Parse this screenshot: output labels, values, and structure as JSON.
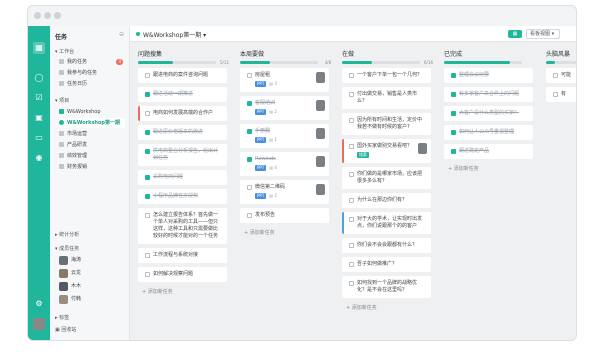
{
  "app": {
    "sidebar_title": "任务",
    "project_title": "W&Workshop第一期",
    "view_label": "看板视图"
  },
  "sidebar": {
    "workspace_label": "工作台",
    "items": [
      {
        "label": "我的任务",
        "badge": "4"
      },
      {
        "label": "我参与的任务"
      },
      {
        "label": "任务日历"
      }
    ],
    "project_label": "项目",
    "projects": [
      {
        "label": "W&Workshop"
      },
      {
        "label": "W&Workshop第一期"
      },
      {
        "label": "市场运营"
      },
      {
        "label": "产品研发"
      },
      {
        "label": "绩效管理"
      },
      {
        "label": "财务报销"
      }
    ],
    "stats_label": "统计分析",
    "members_label": "成员任务",
    "members": [
      {
        "name": "海涛"
      },
      {
        "name": "云龙"
      },
      {
        "name": "木木"
      },
      {
        "name": "付韩"
      }
    ],
    "bottom": [
      "标签",
      "回收站"
    ]
  },
  "columns": [
    {
      "title": "问题搜集",
      "count": "5/11",
      "progress": 0.45,
      "cards": [
        {
          "text": "跟进电商的案件咨询问题",
          "done": false
        },
        {
          "text": "跟进活动一期推进",
          "done": true
        },
        {
          "text": "电商如何发展高端的合作户",
          "done": false,
          "border": "red"
        },
        {
          "text": "跟进原价格版本的改进",
          "done": true
        },
        {
          "text": "供电商整合分析报告，给出计划任务",
          "done": true
        },
        {
          "text": "采购电商问题",
          "done": true
        },
        {
          "text": "小程序品牌官方授权",
          "done": true
        },
        {
          "text": "怎么建立报告体系？首先做一个单人对采购的工具——但只这样，这种工具和只需要做比较好的时候才能对的一个任务",
          "done": false
        },
        {
          "text": "工作流程与系统对接",
          "done": false
        },
        {
          "text": "如何解决观察问题",
          "done": false
        }
      ],
      "add_label": "+ 添加新任务"
    },
    {
      "title": "本周要做",
      "count": "3/8",
      "progress": 0.38,
      "cards": [
        {
          "text": "房屋租",
          "done": false,
          "tags": [
            "PPT"
          ],
          "meta": "3"
        },
        {
          "text": "客服培训",
          "done": true,
          "tags": [
            "PPT"
          ],
          "meta": "2"
        },
        {
          "text": "手册翻",
          "done": true,
          "tags": [
            "PPT"
          ],
          "meta": "1"
        },
        {
          "text": "Rewinds",
          "done": true,
          "tags": [
            "PPT"
          ],
          "meta": "4"
        },
        {
          "text": "微信第二维码",
          "done": false,
          "tags": [
            "PPT"
          ],
          "meta": "2"
        },
        {
          "text": "发布预告",
          "done": false
        }
      ],
      "add_label": "+ 添加新任务"
    },
    {
      "title": "在做",
      "count": "6/16",
      "progress": 0.38,
      "cards": [
        {
          "text": "一个客户下单一包一个几何？",
          "done": false
        },
        {
          "text": "付出做交易，销售是人类市么？",
          "done": false
        },
        {
          "text": "因为所有时间和生活，定价中我若不做有时候的客户?",
          "done": false
        },
        {
          "text": "国外买家做别交易看吧？",
          "done": false,
          "tags": [
            "搜索"
          ],
          "border": "red"
        },
        {
          "text": "你们做的是哪家市场，应该把很多多么有？",
          "done": false
        },
        {
          "text": "为什么在那边你们有？",
          "done": false
        },
        {
          "text": "对于大的学术，让实现时出发点，你们说跟那个的的客户",
          "done": false,
          "border": "blue"
        },
        {
          "text": "你们会不会会跟都有什么？",
          "done": false
        },
        {
          "text": "吾子如何做推广？",
          "done": false
        },
        {
          "text": "如何找到一个品牌的战略优化？是不会在这里吗？",
          "done": false
        }
      ],
      "add_label": "+ 添加新任务"
    },
    {
      "title": "已完成",
      "count": "",
      "progress": 0.85,
      "cards": [
        {
          "text": "整理会议纪要",
          "done": true
        },
        {
          "text": "有多家客户来合作上的问题",
          "done": true
        },
        {
          "text": "大客户是什么类型的买家？",
          "done": true
        },
        {
          "text": "如何让人公众号重视整理",
          "done": true
        },
        {
          "text": "跟进确定产品",
          "done": true
        }
      ],
      "add_label": "+ 添加新任务"
    },
    {
      "title": "头脑风暴",
      "count": "",
      "progress": 0.2,
      "cards": [
        {
          "text": "可能",
          "done": false
        },
        {
          "text": "有",
          "done": false
        }
      ],
      "add_label": ""
    }
  ],
  "colors": {
    "accent": "#1fb69c",
    "badge": "#ef6b5c"
  }
}
